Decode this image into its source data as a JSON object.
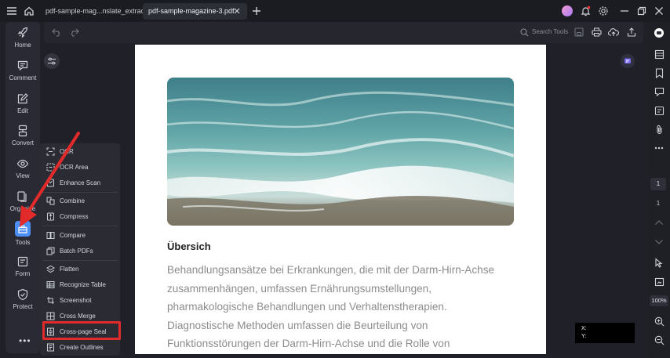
{
  "titlebar": {
    "tabs": [
      {
        "label": "pdf-sample-mag...nslate_extract.pdf",
        "active": false
      },
      {
        "label": "pdf-sample-magazine-3.pdf",
        "active": true
      }
    ],
    "icons": [
      "menu-icon",
      "home-icon",
      "close-icon",
      "add-tab-icon",
      "avatar",
      "bell-icon",
      "settings-icon",
      "minimize-icon",
      "restore-icon",
      "close-window-icon"
    ]
  },
  "toolbar": {
    "search_label": "Search Tools",
    "icons": [
      "undo-icon",
      "redo-icon",
      "search-icon",
      "save-icon",
      "print-icon",
      "cloud-upload-icon",
      "share-icon"
    ]
  },
  "leftnav": {
    "items": [
      {
        "label": "Home",
        "icon": "rocket-icon"
      },
      {
        "label": "Comment",
        "icon": "comment-icon"
      },
      {
        "label": "Edit",
        "icon": "edit-icon"
      },
      {
        "label": "Convert",
        "icon": "convert-icon"
      },
      {
        "label": "View",
        "icon": "eye-icon"
      },
      {
        "label": "Organize",
        "icon": "organize-icon"
      },
      {
        "label": "Tools",
        "icon": "toolbox-icon",
        "active": true
      },
      {
        "label": "Form",
        "icon": "form-icon"
      },
      {
        "label": "Protect",
        "icon": "shield-icon"
      }
    ],
    "more_label": "•••"
  },
  "tools_menu": {
    "items": [
      {
        "label": "OCR",
        "icon": "ocr-icon"
      },
      {
        "label": "OCR Area",
        "icon": "ocr-area-icon"
      },
      {
        "label": "Enhance Scan",
        "icon": "enhance-scan-icon"
      },
      {
        "label": "Combine",
        "icon": "combine-icon"
      },
      {
        "label": "Compress",
        "icon": "compress-icon"
      },
      {
        "label": "Compare",
        "icon": "compare-icon"
      },
      {
        "label": "Batch PDFs",
        "icon": "batch-icon"
      },
      {
        "label": "Flatten",
        "icon": "flatten-icon"
      },
      {
        "label": "Recognize Table",
        "icon": "table-icon"
      },
      {
        "label": "Screenshot",
        "icon": "screenshot-icon"
      },
      {
        "label": "Cross Merge",
        "icon": "cross-merge-icon"
      },
      {
        "label": "Cross-page Seal",
        "icon": "seal-icon",
        "highlighted": true
      },
      {
        "label": "Create Outlines",
        "icon": "outline-icon"
      }
    ]
  },
  "document": {
    "heading": "Übersich",
    "lines": [
      "Behandlungsansätze bei Erkrankungen, die mit der Darm-Hirn-Achse",
      "zusammenhängen, umfassen Ernährungsumstellungen,",
      "pharmakologische Behandlungen und Verhaltenstherapien.",
      "Diagnostische Methoden umfassen die Beurteilung von",
      "Funktionsstörungen der Darm-Hirn-Achse und die Rolle von"
    ],
    "image": "ocean-wave-photo"
  },
  "rightbar": {
    "page_current": "1",
    "page_total": "1",
    "zoom": "100%",
    "icons": [
      "ai-assistant-icon",
      "thumbnails-icon",
      "bookmark-icon",
      "comments-icon",
      "attachments-icon",
      "clip-icon",
      "more-icon",
      "prev-page-icon",
      "next-page-icon",
      "select-cursor-icon",
      "fit-icon",
      "zoom-in-icon",
      "zoom-out-icon"
    ]
  },
  "coords": {
    "x_label": "X:",
    "y_label": "Y:"
  },
  "colors": {
    "accent": "#4c8ef7",
    "highlight": "#e22a2a",
    "annotation_arrow": "#e22a2a"
  }
}
